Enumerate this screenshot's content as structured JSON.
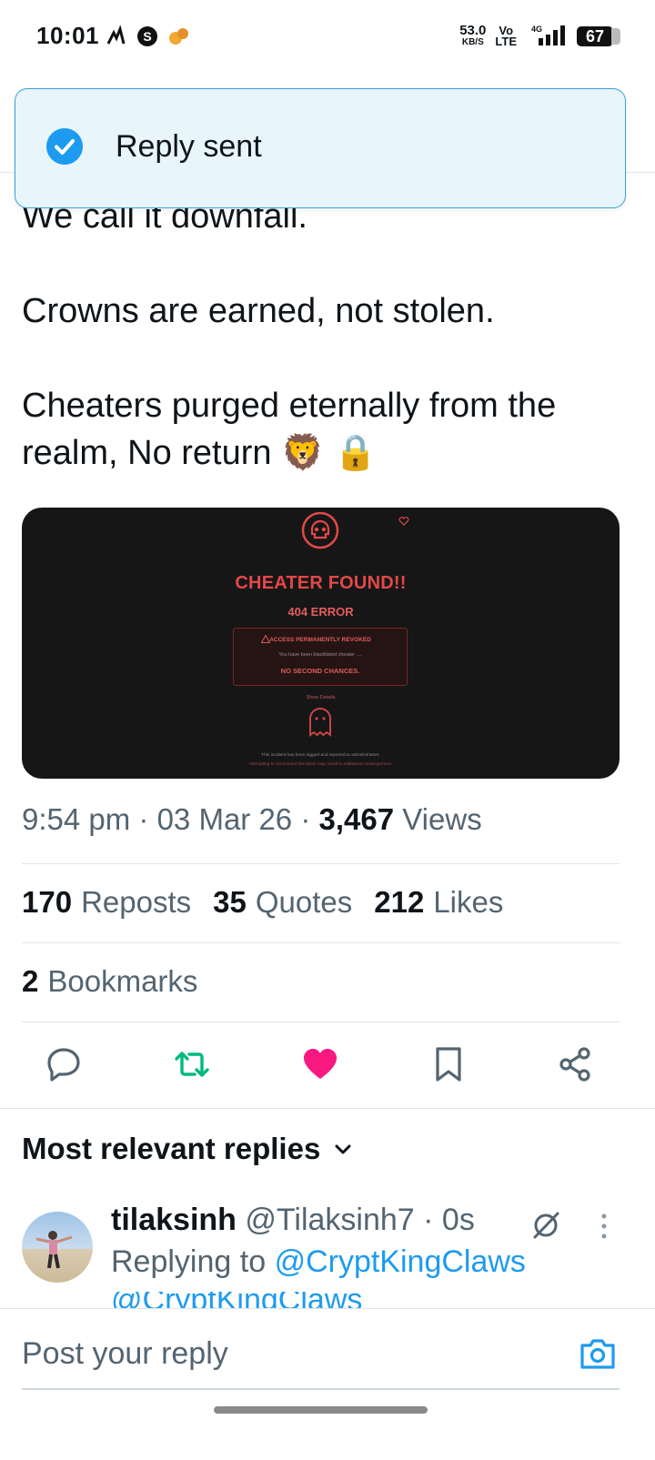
{
  "status_bar": {
    "time": "10:01",
    "speed_value": "53.0",
    "speed_unit": "KB/S",
    "volte_top": "Vo",
    "volte_bottom": "LTE",
    "network": "4G",
    "battery": "67"
  },
  "toast": {
    "message": "Reply sent"
  },
  "tweet": {
    "text_partial": "We call it downfall.",
    "text_2": "Crowns are earned, not stolen.",
    "text_3": "Cheaters purged eternally from the\nrealm, No return 🦁 🔒",
    "media": {
      "title": "CHEATER FOUND!!",
      "subtitle": "404 ERROR",
      "box_line1": "ACCESS PERMANENTLY REVOKED",
      "box_line2": "You have been blacklisted cheater ....",
      "box_line3": "NO SECOND CHANCES.",
      "details": "Show Details",
      "footer1": "This incident has been logged and reported to administrators.",
      "footer2": "Attempting to circumvent this block may result in additional consequences."
    },
    "time": "9:54 pm",
    "date": "03 Mar 26",
    "views_count": "3,467",
    "views_label": "Views",
    "reposts_count": "170",
    "reposts_label": "Reposts",
    "quotes_count": "35",
    "quotes_label": "Quotes",
    "likes_count": "212",
    "likes_label": "Likes",
    "bookmarks_count": "2",
    "bookmarks_label": "Bookmarks"
  },
  "actions": {
    "icons": [
      "reply-icon",
      "repost-icon",
      "like-icon",
      "bookmark-icon",
      "share-icon"
    ],
    "repost_color": "#00ba7c",
    "like_color": "#f91880"
  },
  "replies": {
    "sort_label": "Most relevant replies",
    "items": [
      {
        "name": "tilaksinh",
        "handle": "@Tilaksinh7 · 0s",
        "replying_prefix": "Replying to",
        "replying_to": "@CryptKingClaws",
        "body_partial": "@CryptKingClaws"
      }
    ]
  },
  "composer": {
    "placeholder": "Post your reply"
  },
  "colors": {
    "accent": "#1d9bf0",
    "text": "#0f1419",
    "muted": "#536471",
    "toast_bg": "#e8f6fc"
  }
}
